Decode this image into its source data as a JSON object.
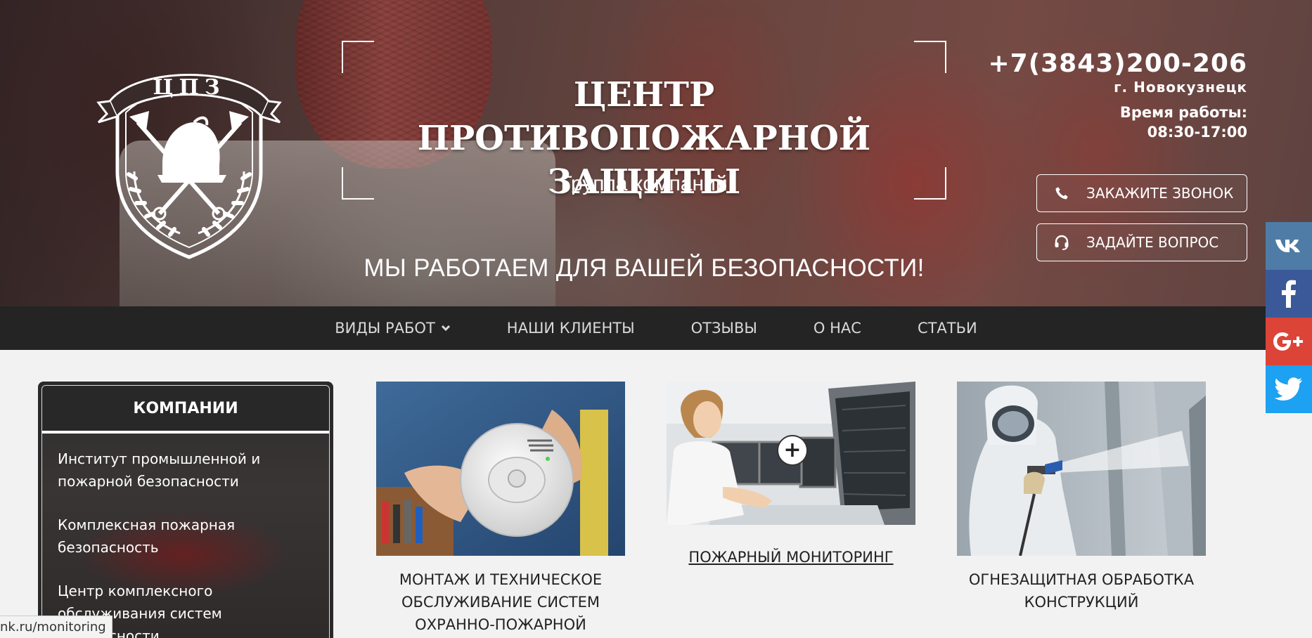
{
  "header": {
    "logo_text": "ЦПЗ",
    "title": "ЦЕНТР ПРОТИВОПОЖАРНОЙ ЗАЩИТЫ",
    "subtitle": "Группа компаний",
    "slogan": "МЫ РАБОТАЕМ ДЛЯ ВАШЕЙ БЕЗОПАСНОСТИ!",
    "phone": "+7(3843)200-206",
    "city": "г. Новокузнецк",
    "hours_label": "Время работы:",
    "hours": "08:30-17:00",
    "call_button": {
      "label": "ЗАКАЖИТЕ ЗВОНОК",
      "icon": "phone-icon"
    },
    "ask_button": {
      "label": "ЗАДАЙТЕ ВОПРОС",
      "icon": "headset-icon"
    }
  },
  "nav": {
    "items": [
      {
        "label": "ВИДЫ РАБОТ",
        "has_dropdown": true
      },
      {
        "label": "НАШИ КЛИЕНТЫ"
      },
      {
        "label": "ОТЗЫВЫ"
      },
      {
        "label": "О НАС"
      },
      {
        "label": "СТАТЬИ"
      }
    ]
  },
  "social": [
    {
      "name": "vk",
      "color": "#4e7ca6"
    },
    {
      "name": "facebook",
      "color": "#3b5998"
    },
    {
      "name": "google-plus",
      "color": "#dc4437"
    },
    {
      "name": "twitter",
      "color": "#1da1f2"
    }
  ],
  "sidebar": {
    "heading": "КОМПАНИИ",
    "items": [
      "Институт промышленной и пожарной безопасности",
      "Комплексная пожарная безопасность",
      "Центр комплексного обслуживания систем безопасности"
    ]
  },
  "cards": [
    {
      "caption": "МОНТАЖ И ТЕХНИЧЕСКОЕ ОБСЛУЖИВАНИЕ СИСТЕМ ОХРАННО-ПОЖАРНОЙ"
    },
    {
      "caption": "ПОЖАРНЫЙ МОНИТОРИНГ"
    },
    {
      "caption": "ОГНЕЗАЩИТНАЯ ОБРАБОТКА КОНСТРУКЦИЙ"
    }
  ],
  "statusbar": {
    "url": "nk.ru/monitoring"
  }
}
